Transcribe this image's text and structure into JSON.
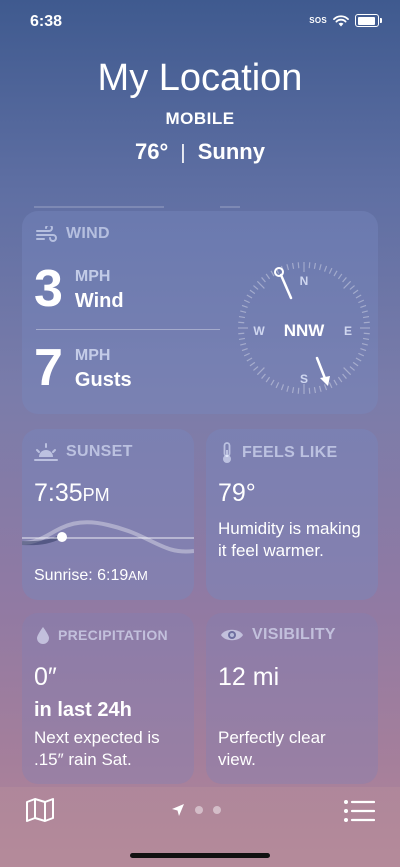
{
  "status": {
    "time": "6:38",
    "sos": "SOS"
  },
  "header": {
    "title": "My Location",
    "subtitle": "MOBILE",
    "temp": "76°",
    "separator": "|",
    "condition": "Sunny"
  },
  "wind": {
    "label": "WIND",
    "speed": {
      "value": "3",
      "unit": "MPH",
      "desc": "Wind"
    },
    "gusts": {
      "value": "7",
      "unit": "MPH",
      "desc": "Gusts"
    },
    "direction": "NNW",
    "compass": {
      "n": "N",
      "e": "E",
      "s": "S",
      "w": "W"
    }
  },
  "sunset": {
    "label": "SUNSET",
    "time": "7:35",
    "ampm": "PM",
    "sunrise_label": "Sunrise: 6:19",
    "sunrise_ampm": "AM"
  },
  "feels_like": {
    "label": "FEELS LIKE",
    "value": "79°",
    "description": "Humidity is making it feel warmer."
  },
  "precipitation": {
    "label": "PRECIPITATION",
    "value": "0″",
    "period": "in last 24h",
    "forecast": "Next expected is .15″ rain Sat."
  },
  "visibility": {
    "label": "VISIBILITY",
    "value": "12 mi",
    "description": "Perfectly clear view."
  },
  "bottom": {
    "map_icon": "map-icon",
    "location_icon": "location-arrow-icon",
    "list_icon": "list-icon",
    "page_count": 3
  }
}
